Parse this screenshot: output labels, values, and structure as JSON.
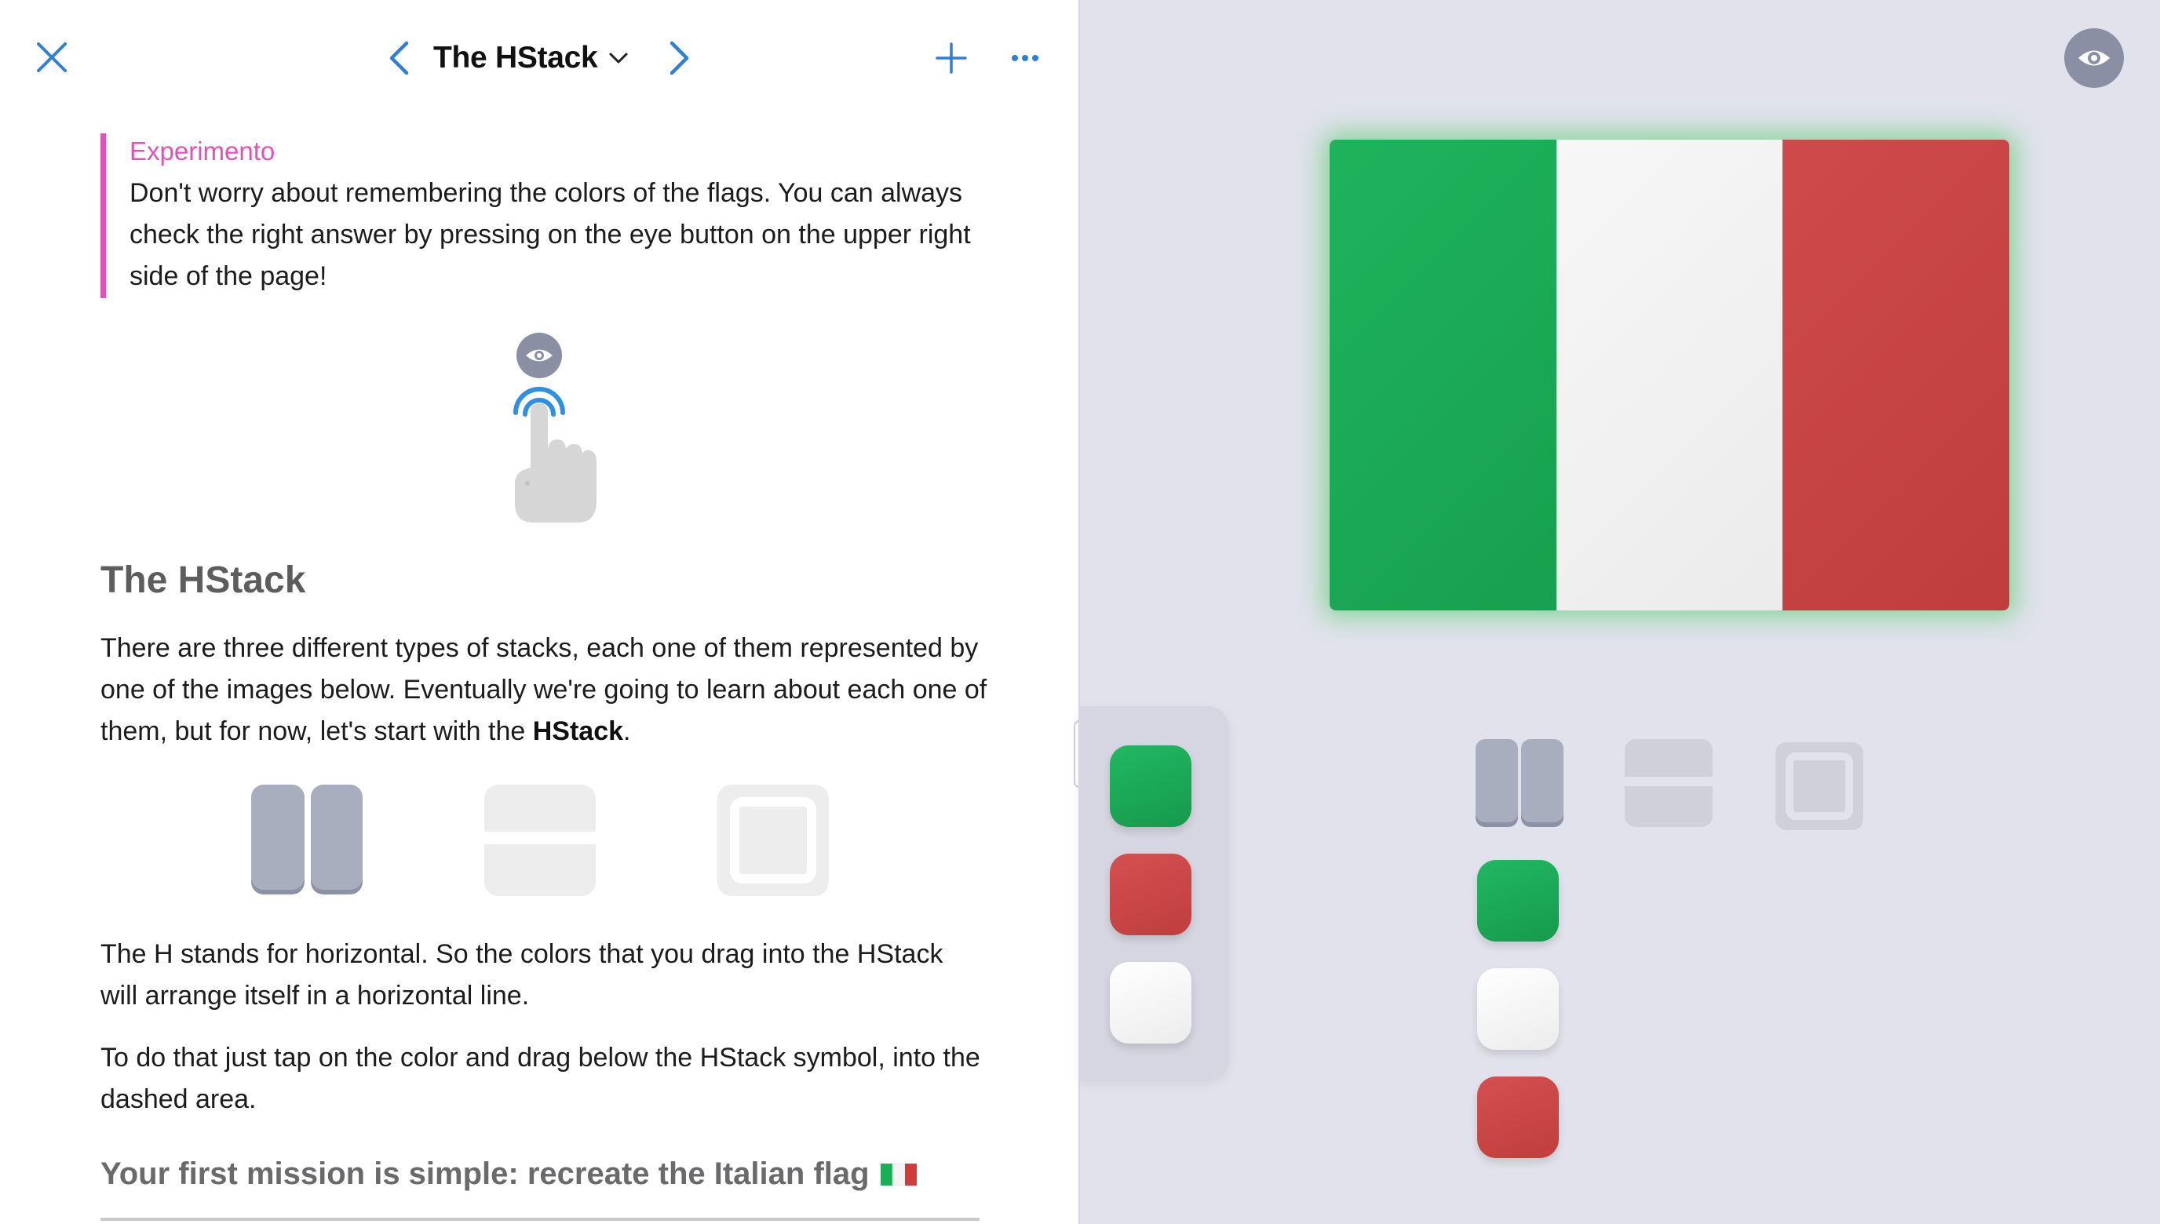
{
  "nav": {
    "title": "The HStack",
    "close_icon": "close-icon",
    "prev_icon": "chevron-left-icon",
    "next_icon": "chevron-right-icon",
    "dropdown_icon": "chevron-down-icon",
    "add_icon": "plus-icon",
    "more_icon": "ellipsis-icon"
  },
  "callout": {
    "label": "Experimento",
    "body": "Don't worry about remembering the colors of the flags. You can always check the right answer by pressing on the eye button on the upper right side of the page!"
  },
  "section": {
    "heading": "The HStack",
    "intro_part1": "There are three different types of stacks, each one of them represented by one of the images below. Eventually we're going to learn about each one of them, but for now, let's start with the ",
    "intro_bold": "HStack",
    "intro_part2": ".",
    "para2": "The H stands for horizontal. So the colors that you drag into the HStack will arrange itself in a horizontal line.",
    "para3": "To do that just tap on the color and drag below the HStack symbol, into the dashed area.",
    "mission": "Your first mission is simple: recreate the Italian flag",
    "mission_flag_icon": "italian-flag-emoji"
  },
  "stack_types": [
    "hstack-icon",
    "vstack-icon",
    "zstack-icon"
  ],
  "colors": {
    "accent": "#2f7fd8",
    "callout": "#e052b6",
    "green": "#1bab55",
    "white": "#f4f4f4",
    "red": "#cc4444",
    "stack_gray": "#a9aebf"
  },
  "flag": {
    "stripes": [
      "#1aae57",
      "#f4f4f4",
      "#c94545"
    ],
    "orientation": "vertical-stripes"
  },
  "palette": {
    "swatches": [
      "#1bab55",
      "#cc4444",
      "#f4f4f4"
    ]
  },
  "answer_stack": {
    "swatches": [
      "#1bab55",
      "#f4f4f4",
      "#cc4444"
    ]
  },
  "eye_button_icon": "eye-icon"
}
